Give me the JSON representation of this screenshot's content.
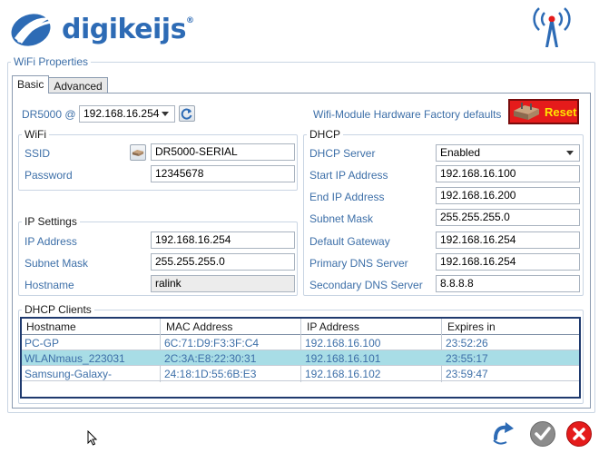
{
  "brand": {
    "name": "digikeijs",
    "reg": "®"
  },
  "group_title": "WiFi Properties",
  "tabs": [
    {
      "label": "Basic",
      "active": true
    },
    {
      "label": "Advanced",
      "active": false
    }
  ],
  "device": {
    "label": "DR5000 @",
    "ip": "192.168.16.254"
  },
  "factory": {
    "label": "Wifi-Module Hardware Factory defaults",
    "reset_label": "Reset"
  },
  "wifi": {
    "title": "WiFi",
    "ssid_label": "SSID",
    "ssid": "DR5000-SERIAL",
    "password_label": "Password",
    "password": "12345678"
  },
  "ip_settings": {
    "title": "IP Settings",
    "ip_label": "IP Address",
    "ip": "192.168.16.254",
    "mask_label": "Subnet Mask",
    "mask": "255.255.255.0",
    "host_label": "Hostname",
    "host": "ralink"
  },
  "dhcp": {
    "title": "DHCP",
    "server_label": "DHCP Server",
    "server": "Enabled",
    "start_label": "Start IP Address",
    "start": "192.168.16.100",
    "end_label": "End IP Address",
    "end": "192.168.16.200",
    "mask_label": "Subnet Mask",
    "mask": "255.255.255.0",
    "gw_label": "Default Gateway",
    "gw": "192.168.16.254",
    "dns1_label": "Primary DNS Server",
    "dns1": "192.168.16.254",
    "dns2_label": "Secondary DNS Server",
    "dns2": "8.8.8.8"
  },
  "clients": {
    "title": "DHCP Clients",
    "headers": [
      "Hostname",
      "MAC Address",
      "IP Address",
      "Expires in"
    ],
    "rows": [
      [
        "PC-GP",
        "6C:71:D9:F3:3F:C4",
        "192.168.16.100",
        "23:52:26"
      ],
      [
        "WLANmaus_223031",
        "2C:3A:E8:22:30:31",
        "192.168.16.101",
        "23:55:17"
      ],
      [
        "Samsung-Galaxy-",
        "24:18:1D:55:6B:E3",
        "192.168.16.102",
        "23:59:47"
      ]
    ],
    "selected_row": 1
  },
  "colors": {
    "accent": "#3d6fa8",
    "brand": "#2d6bb5",
    "selected": "#a8dde6",
    "reset": "#e51b1b"
  },
  "icons": [
    "wifi-antenna-icon",
    "refresh-icon",
    "router-icon",
    "undo-icon",
    "ok-icon",
    "cancel-icon"
  ]
}
